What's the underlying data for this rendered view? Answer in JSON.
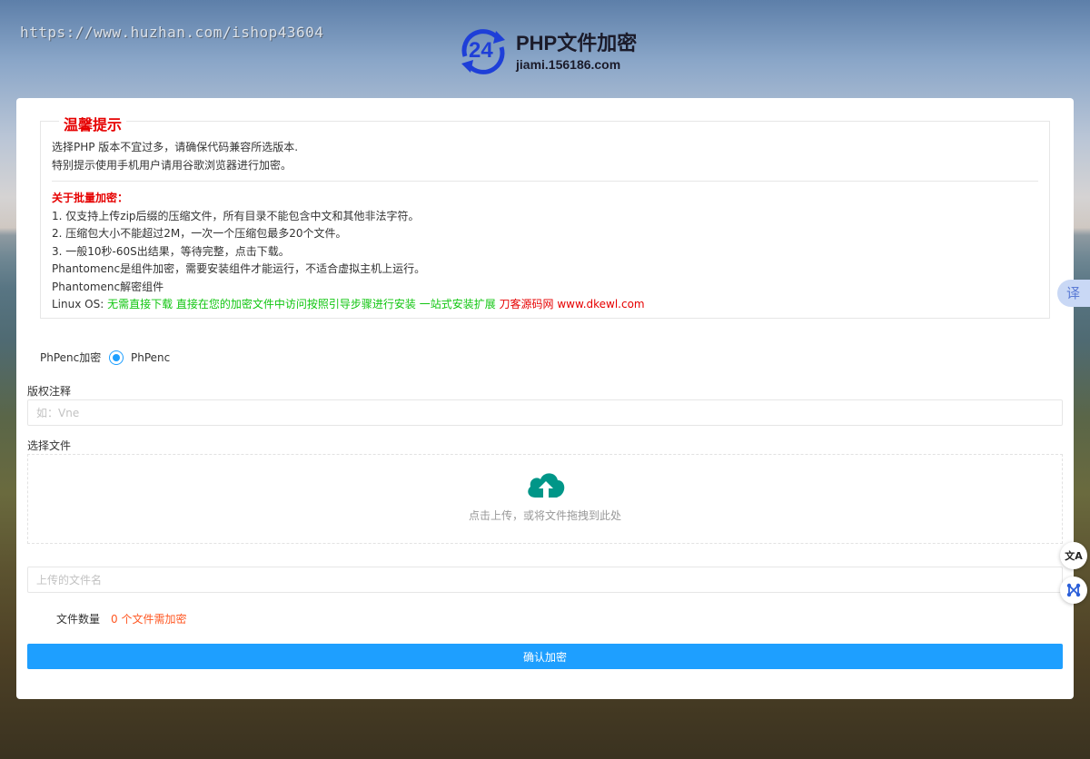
{
  "watermark": "https://www.huzhan.com/ishop43604",
  "logo": {
    "badge_number": "24",
    "title": "PHP文件加密",
    "domain": "jiami.156186.com"
  },
  "notice": {
    "legend": "温馨提示",
    "line1": "选择PHP 版本不宜过多，请确保代码兼容所选版本.",
    "line2": "特别提示使用手机用户请用谷歌浏览器进行加密。",
    "batch_title": "关于批量加密：",
    "item1": "1. 仅支持上传zip后缀的压缩文件，所有目录不能包含中文和其他非法字符。",
    "item2": "2. 压缩包大小不能超过2M，一次一个压缩包最多20个文件。",
    "item3": "3. 一般10秒-60S出结果，等待完整，点击下载。",
    "phantom1": "Phantomenc是组件加密，需要安装组件才能运行，不适合虚拟主机上运行。",
    "phantom2": "Phantomenc解密组件",
    "linux_prefix": "Linux OS: ",
    "linux_green": "无需直接下载 直接在您的加密文件中访问按照引导步骤进行安装 一站式安装扩展 ",
    "linux_red": "刀客源码网 www.dkewl.com"
  },
  "form": {
    "encrypt_label": "PhPenc加密",
    "encrypt_option": "PhPenc",
    "copyright_label": "版权注释",
    "copyright_placeholder": "如：Vne",
    "file_label": "选择文件",
    "upload_hint": "点击上传，或将文件拖拽到此处",
    "filename_placeholder": "上传的文件名",
    "count_label": "文件数量",
    "count_value": "0 个文件需加密",
    "submit_label": "确认加密"
  },
  "side": {
    "translate_tab": "译",
    "translate_icon": "文A"
  },
  "colors": {
    "accent": "#1e9fff",
    "warning_red": "#e60000",
    "highlight_green": "#11c611",
    "count_orange": "#ff5722",
    "upload_icon": "#009688"
  }
}
